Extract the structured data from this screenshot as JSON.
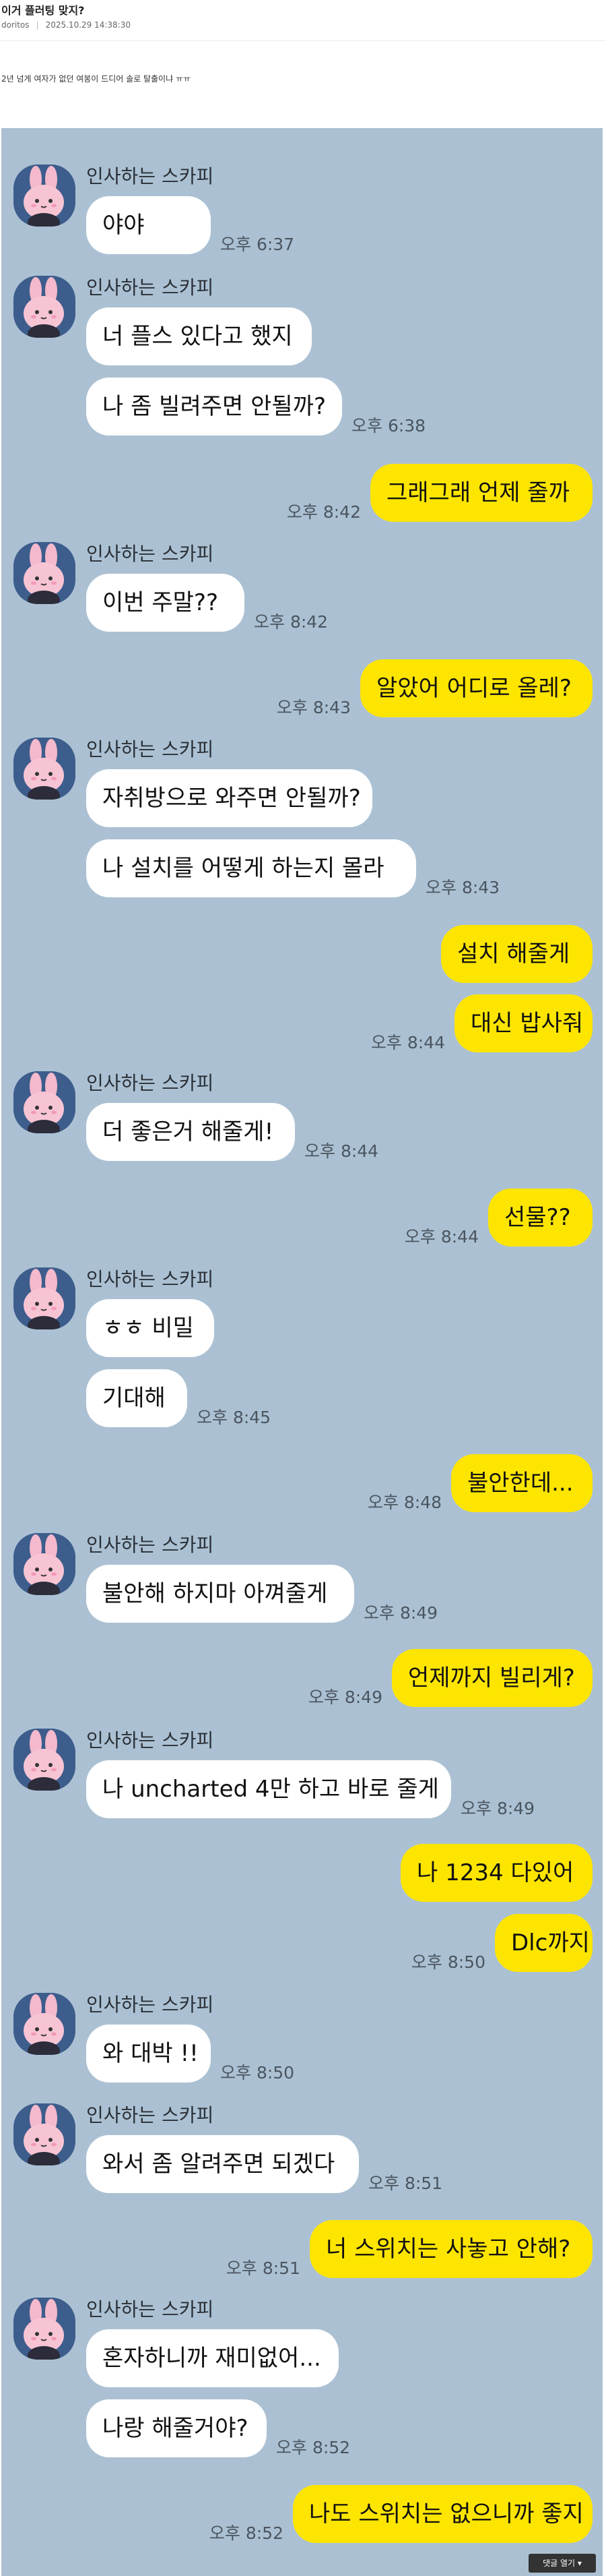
{
  "post": {
    "title": "이거 플러팅 맞지?",
    "author": "doritos",
    "date": "2025.10.29 14:38:30",
    "body": "2년 넘게 여자가 없던 여봉이 드디어 솔로 탈출이냐 ㅠㅠ"
  },
  "chat": {
    "sender_name": "인사하는 스카피",
    "messages": [
      {
        "text": "야야",
        "time": "오후 6:37"
      },
      {
        "text": "너 플스 있다고 했지",
        "time": ""
      },
      {
        "text": "나 좀 빌려주면 안될까?",
        "time": "오후 6:38"
      },
      {
        "text": "그래그래 언제 줄까",
        "time": "오후 8:42"
      },
      {
        "text": "이번 주말??",
        "time": "오후 8:42"
      },
      {
        "text": "알았어 어디로 올레?",
        "time": "오후 8:43"
      },
      {
        "text": "자취방으로 와주면 안될까?",
        "time": ""
      },
      {
        "text": "나 설치를 어떻게 하는지 몰라",
        "time": "오후 8:43"
      },
      {
        "text": "설치 해줄게",
        "time": ""
      },
      {
        "text": "대신 밥사줘",
        "time": "오후 8:44"
      },
      {
        "text": "더 좋은거 해줄게!",
        "time": "오후 8:44"
      },
      {
        "text": "선물??",
        "time": "오후 8:44"
      },
      {
        "text": "ㅎㅎ 비밀",
        "time": ""
      },
      {
        "text": "기대해",
        "time": "오후 8:45"
      },
      {
        "text": "불안한데...",
        "time": "오후 8:48"
      },
      {
        "text": "불안해 하지마 아껴줄게",
        "time": "오후 8:49"
      },
      {
        "text": "언제까지 빌리게?",
        "time": "오후 8:49"
      },
      {
        "text": "나 uncharted 4만 하고 바로 줄게",
        "time": "오후 8:49"
      },
      {
        "text": "나 1234 다있어",
        "time": ""
      },
      {
        "text": "Dlc까지",
        "time": "오후 8:50"
      },
      {
        "text": "와 대박 !!",
        "time": "오후 8:50"
      },
      {
        "text": "와서 좀 알려주면 되겠다",
        "time": "오후 8:51"
      },
      {
        "text": "너 스위치는 사놓고 안해?",
        "time": "오후 8:51"
      },
      {
        "text": "혼자하니까 재미없어...",
        "time": ""
      },
      {
        "text": "나랑 해줄거야?",
        "time": "오후 8:52"
      },
      {
        "text": "나도 스위치는 없으니까 좋지",
        "time": "오후 8:52"
      }
    ]
  },
  "footer": {
    "comment_button": "댓글 열기 ▾"
  },
  "colors": {
    "chat_background": "#abc1d3",
    "incoming_bubble": "#ffffff",
    "outgoing_bubble": "#fee500",
    "avatar_background": "#3d5d8c"
  }
}
